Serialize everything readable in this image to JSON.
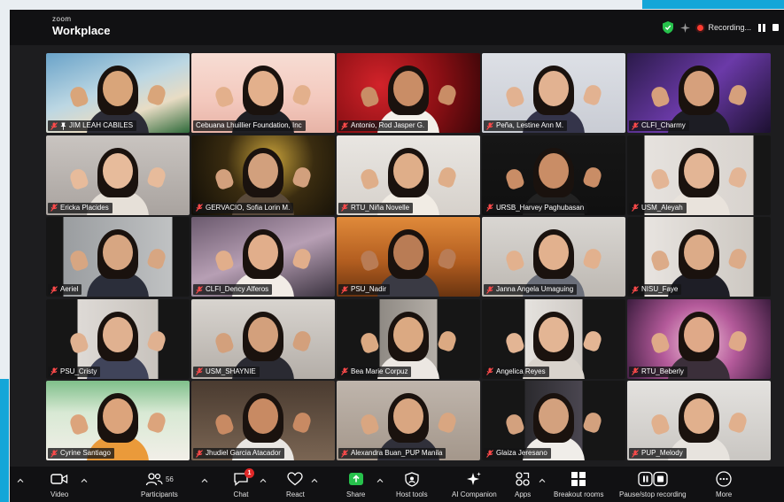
{
  "app": {
    "brand_small": "zoom",
    "brand_big": "Workplace",
    "recording_label": "Recording..."
  },
  "colors": {
    "accent": "#14a6d8",
    "active_speaker": "#6fe38c",
    "share_green": "#27c24c",
    "record_red": "#ff3b30",
    "window_bg": "#1d1d1f"
  },
  "participants": [
    {
      "name": "JIM LEAH CABILES",
      "pinned": true,
      "muted": true
    },
    {
      "name": "Cebuana Lhuillier Foundation, Inc",
      "pinned": false,
      "muted": false,
      "active_speaker": true
    },
    {
      "name": "Antonio, Rod Jasper G.",
      "pinned": false,
      "muted": true
    },
    {
      "name": "Peña, Lestine Ann M.",
      "pinned": false,
      "muted": true
    },
    {
      "name": "CLFI_Charmy",
      "pinned": false,
      "muted": true
    },
    {
      "name": "Ericka Placides",
      "pinned": false,
      "muted": true
    },
    {
      "name": "GERVACIO, Sofia Lorin M.",
      "pinned": false,
      "muted": true
    },
    {
      "name": "RTU_Niña Novelle",
      "pinned": false,
      "muted": true
    },
    {
      "name": "URSB_Harvey Paghubasan",
      "pinned": false,
      "muted": true
    },
    {
      "name": "USM_Aleyah",
      "pinned": false,
      "muted": true
    },
    {
      "name": "Aeriel",
      "pinned": false,
      "muted": true
    },
    {
      "name": "CLFI_Dency Alferos",
      "pinned": false,
      "muted": true
    },
    {
      "name": "PSU_Nadir",
      "pinned": false,
      "muted": true
    },
    {
      "name": "Janna Angela Umaguing",
      "pinned": false,
      "muted": true
    },
    {
      "name": "NISU_Faye",
      "pinned": false,
      "muted": true
    },
    {
      "name": "PSU_Cristy",
      "pinned": false,
      "muted": true
    },
    {
      "name": "USM_SHAYNIE",
      "pinned": false,
      "muted": true
    },
    {
      "name": "Bea Marie Corpuz",
      "pinned": false,
      "muted": true
    },
    {
      "name": "Angelica Reyes",
      "pinned": false,
      "muted": true
    },
    {
      "name": "RTU_Beberly",
      "pinned": false,
      "muted": true
    },
    {
      "name": "Cyrine Santiago",
      "pinned": false,
      "muted": true
    },
    {
      "name": "Jhudiel Garcia Atacador",
      "pinned": false,
      "muted": true
    },
    {
      "name": "Alexandra Buan_PUP Manila",
      "pinned": false,
      "muted": true
    },
    {
      "name": "Glaiza Jeresano",
      "pinned": false,
      "muted": true
    },
    {
      "name": "PUP_Melody",
      "pinned": false,
      "muted": true
    }
  ],
  "toolbar": {
    "video": "Video",
    "participants": "Participants",
    "participants_count": "56",
    "chat": "Chat",
    "chat_badge": "1",
    "react": "React",
    "share": "Share",
    "host_tools": "Host tools",
    "ai_companion": "AI Companion",
    "apps": "Apps",
    "breakout_rooms": "Breakout rooms",
    "pause_stop": "Pause/stop recording",
    "more": "More"
  }
}
